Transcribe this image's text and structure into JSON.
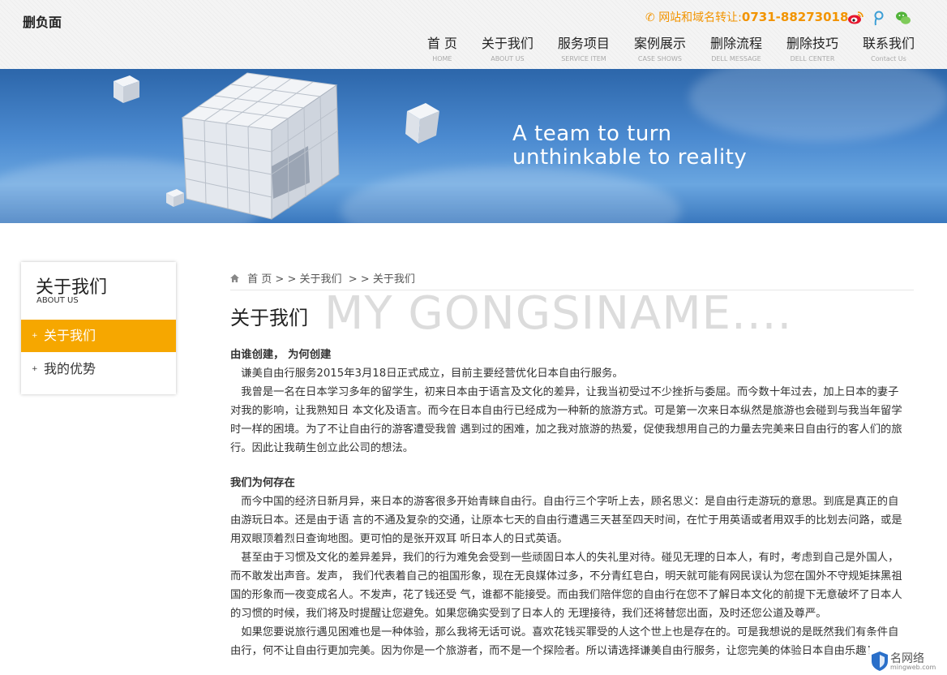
{
  "header": {
    "logo": "删负面",
    "hotline_label": "网站和域名转让:",
    "hotline_number": "0731-88273018",
    "social_icons": [
      "weibo-icon",
      "tencent-weibo-icon",
      "wechat-icon"
    ],
    "nav": [
      {
        "cn": "首 页",
        "en": "HOME"
      },
      {
        "cn": "关于我们",
        "en": "ABOUT US"
      },
      {
        "cn": "服务项目",
        "en": "SERVICE ITEM"
      },
      {
        "cn": "案例展示",
        "en": "CASE SHOWS"
      },
      {
        "cn": "删除流程",
        "en": "DELL MESSAGE"
      },
      {
        "cn": "删除技巧",
        "en": "DELL CENTER"
      },
      {
        "cn": "联系我们",
        "en": "Contact Us"
      }
    ]
  },
  "banner": {
    "line1": "A team to turn",
    "line2": "unthinkable to reality"
  },
  "sidebar": {
    "title": "关于我们",
    "subtitle": "ABOUT US",
    "items": [
      {
        "label": "关于我们",
        "active": true
      },
      {
        "label": "我的优势",
        "active": false
      }
    ]
  },
  "breadcrumb": {
    "home": "首 页",
    "sep1": "> >",
    "level1": "关于我们",
    "sep2": "> >",
    "level2": "关于我们"
  },
  "main": {
    "title": "关于我们",
    "watermark": "MY GONGSINAME....",
    "heading1": "由谁创建， 为何创建",
    "p1": "谦美自由行服务2015年3月18日正式成立，目前主要经营优化日本自由行服务。",
    "p2": "我曾是一名在日本学习多年的留学生，初来日本由于语言及文化的差异，让我当初受过不少挫折与委屈。而今数十年过去，加上日本的妻子对我的影响，让我熟知日 本文化及语言。而今在日本自由行已经成为一种新的旅游方式。可是第一次来日本纵然是旅游也会碰到与我当年留学时一样的困境。为了不让自由行的游客遭受我曾 遇到过的困难，加之我对旅游的热爱，促使我想用自己的力量去完美来日自由行的客人们的旅行。因此让我萌生创立此公司的想法。",
    "heading2": "我们为何存在",
    "p3": "而今中国的经济日新月异，来日本的游客很多开始青睐自由行。自由行三个字听上去，顾名思义：是自由行走游玩的意思。到底是真正的自由游玩日本。还是由于语 言的不通及复杂的交通，让原本七天的自由行遭遇三天甚至四天时间，在忙于用英语或者用双手的比划去问路，或是用双眼顶着烈日查询地图。更可怕的是张开双耳 听日本人的日式英语。",
    "p4": "甚至由于习惯及文化的差异差异，我们的行为难免会受到一些顽固日本人的失礼里对待。碰见无理的日本人，有时，考虑到自己是外国人，而不敢发出声音。发声， 我们代表着自己的祖国形象，现在无良媒体过多，不分青红皂白，明天就可能有网民误认为您在国外不守规矩抹黑祖国的形象而一夜变成名人。不发声，花了钱还受 气，谁都不能接受。而由我们陪伴您的自由行在您不了解日本文化的前提下无意破坏了日本人的习惯的时候，我们将及时提醒让您避免。如果您确实受到了日本人的 无理接待，我们还将替您出面，及时还您公道及尊严。",
    "p5": "如果您要说旅行遇见困难也是一种体验，那么我将无话可说。喜欢花钱买罪受的人这个世上也是存在的。可是我想说的是既然我们有条件自由行，何不让自由行更加完美。因为你是一个旅游者，而不是一个探险者。所以请选择谦美自由行服务，让您完美的体验日本自由乐趣！"
  },
  "corner_badge": {
    "cn": "名网络",
    "en": "mingweb.com"
  },
  "colors": {
    "accent": "#f6a700",
    "hotline": "#f29400",
    "banner": "#4b8ad0"
  }
}
